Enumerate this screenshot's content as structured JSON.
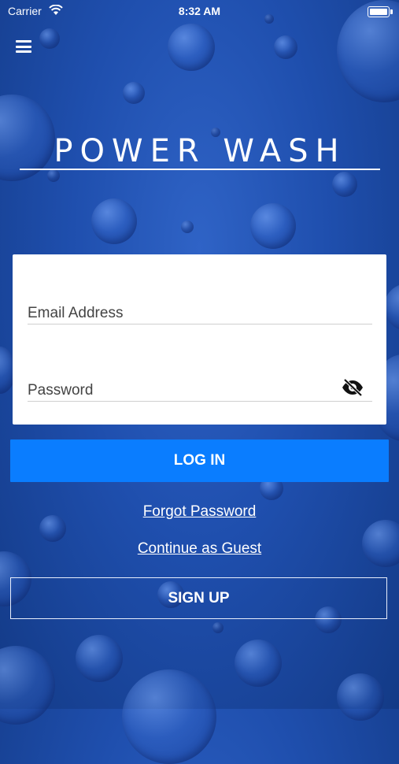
{
  "status_bar": {
    "carrier": "Carrier",
    "time": "8:32 AM"
  },
  "header": {
    "menu_icon": "hamburger-menu-icon"
  },
  "logo": {
    "text": "POWER WASH"
  },
  "form": {
    "email": {
      "label": "Email Address",
      "value": ""
    },
    "password": {
      "label": "Password",
      "value": "",
      "toggle_icon": "eye-slash-icon"
    }
  },
  "actions": {
    "login_label": "LOG IN",
    "forgot_password_label": "Forgot Password",
    "guest_label": "Continue as Guest",
    "signup_label": "SIGN UP"
  },
  "colors": {
    "primary_button": "#0a7dff",
    "background": "#1f4fae",
    "card": "#ffffff"
  }
}
